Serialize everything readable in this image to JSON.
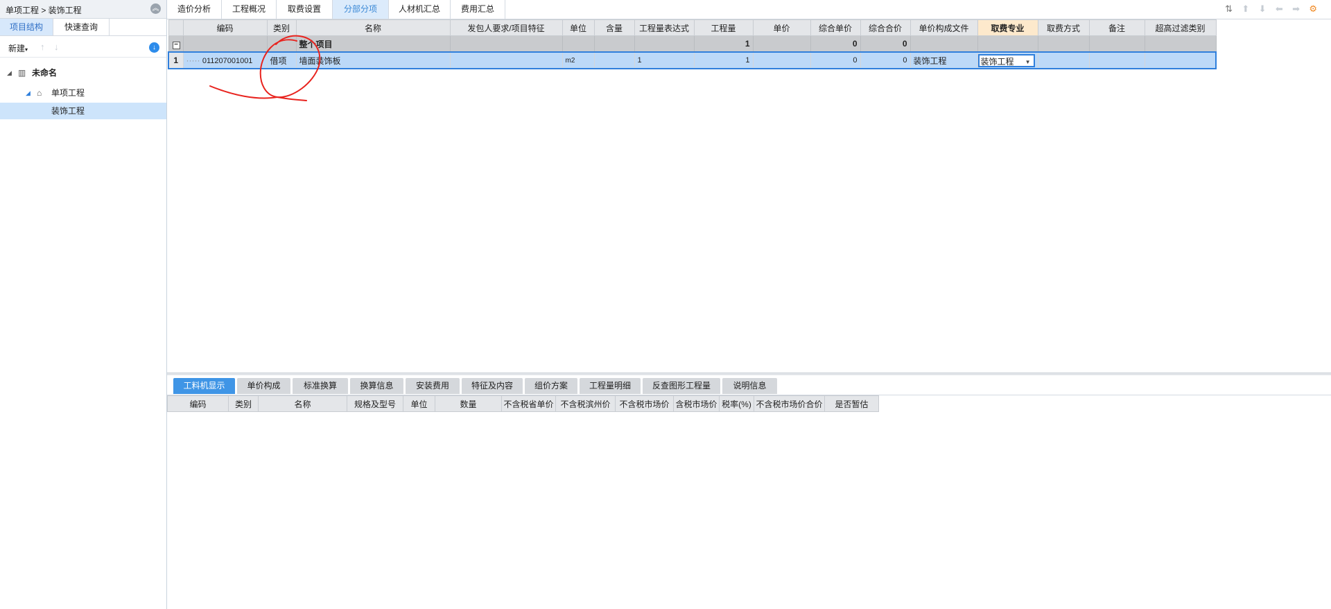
{
  "left_panel": {
    "breadcrumb": "单项工程 > 装饰工程",
    "collapse_icon": "double-chevron-up-icon",
    "tabs": [
      "项目结构",
      "快速查询"
    ],
    "toolbar": {
      "new_label": "新建",
      "download_icon": "download-circle-icon"
    },
    "tree": [
      {
        "label": "未命名",
        "icon": "building-icon"
      },
      {
        "label": "单项工程",
        "icon": "home-icon"
      },
      {
        "label": "装饰工程"
      }
    ]
  },
  "top_tabs": [
    "造价分析",
    "工程概况",
    "取费设置",
    "分部分项",
    "人材机汇总",
    "费用汇总"
  ],
  "active_top_tab": "分部分项",
  "main_grid": {
    "columns": [
      "编码",
      "类别",
      "名称",
      "发包人要求/项目特征",
      "单位",
      "含量",
      "工程量表达式",
      "工程量",
      "单价",
      "综合单价",
      "综合合价",
      "单价构成文件",
      "取费专业",
      "取费方式",
      "备注",
      "超高过滤类别"
    ],
    "selected_column": "取费专业",
    "group_row": {
      "toggle": "−",
      "name": "整个项目",
      "quantity": "1",
      "unit_total": "0",
      "total": "0"
    },
    "rows": [
      {
        "row_number": "1",
        "code": "011207001001",
        "category": "借项",
        "name": "墙面装饰板",
        "spec": "",
        "unit": "m2",
        "content": "",
        "expression": "1",
        "quantity": "1",
        "price": "",
        "unit_total": "0",
        "total": "0",
        "composition_file": "装饰工程",
        "fee_specialty": "装饰工程",
        "fee_method": "",
        "remark": "",
        "height_filter": ""
      }
    ]
  },
  "bottom_tabs": [
    "工料机显示",
    "单价构成",
    "标准换算",
    "换算信息",
    "安装费用",
    "特征及内容",
    "组价方案",
    "工程量明细",
    "反查图形工程量",
    "说明信息"
  ],
  "active_bottom_tab": "工料机显示",
  "bottom_grid": {
    "columns": [
      "编码",
      "类别",
      "名称",
      "规格及型号",
      "单位",
      "数量",
      "不含税省单价",
      "不含税滨州价",
      "不含税市场价",
      "含税市场价",
      "税率(%)",
      "不含税市场价合价",
      "是否暂估"
    ]
  },
  "colors": {
    "accent": "#3f95e6",
    "selected_row": "#bcd9f8",
    "selection_border": "#2f7fdc",
    "annotation": "#e8231e"
  }
}
